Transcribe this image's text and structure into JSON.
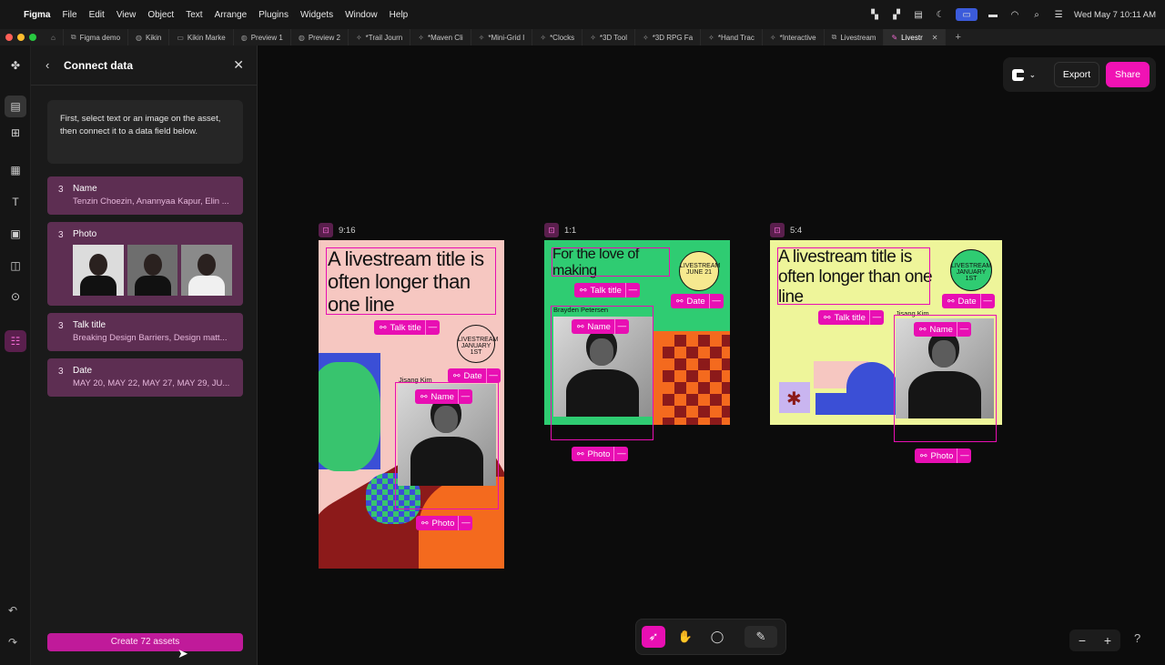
{
  "menubar": {
    "apple": "",
    "app": "Figma",
    "items": [
      "File",
      "Edit",
      "View",
      "Object",
      "Text",
      "Arrange",
      "Plugins",
      "Widgets",
      "Window",
      "Help"
    ],
    "datetime": "Wed May 7  10:11 AM"
  },
  "tabs": [
    {
      "label": "Figma demo"
    },
    {
      "label": "Kikin"
    },
    {
      "label": "Kikin Marke"
    },
    {
      "label": "Preview 1"
    },
    {
      "label": "Preview 2"
    },
    {
      "label": "*Trail Journ"
    },
    {
      "label": "*Maven Cli"
    },
    {
      "label": "*Mini-Grid I"
    },
    {
      "label": "*Clocks"
    },
    {
      "label": "*3D Tool"
    },
    {
      "label": "*3D RPG Fa"
    },
    {
      "label": "*Hand Trac"
    },
    {
      "label": "*Interactive"
    },
    {
      "label": "Livestream"
    },
    {
      "label": "Livestr"
    }
  ],
  "panel": {
    "title": "Connect data",
    "help": "First, select text or an image on the asset, then connect it to a data field below.",
    "fields": [
      {
        "count": "3",
        "label": "Name",
        "values": "Tenzin Choezin, Anannyaa Kapur, Elin ..."
      },
      {
        "count": "3",
        "label": "Photo",
        "values": ""
      },
      {
        "count": "3",
        "label": "Talk title",
        "values": "Breaking Design Barriers, Design matt..."
      },
      {
        "count": "3",
        "label": "Date",
        "values": "MAY 20, MAY 22, MAY 27, MAY 29, JU..."
      }
    ],
    "create_label": "Create 72 assets"
  },
  "header": {
    "export": "Export",
    "share": "Share"
  },
  "frames": [
    {
      "ratio": "9:16",
      "headline": "A livestream title is often longer than one line",
      "person": "Jisang Kim",
      "badge": "LIVESTREAM JANUARY 1ST"
    },
    {
      "ratio": "1:1",
      "headline": "For the love of making",
      "person": "Brayden Petersen",
      "badge": "LIVESTREAM JUNE 21"
    },
    {
      "ratio": "5:4",
      "headline": "A livestream title is often longer than one line",
      "person": "Jisang Kim",
      "badge": "LIVESTREAM JANUARY 1ST"
    }
  ],
  "chips": {
    "talk": "Talk title",
    "date": "Date",
    "name": "Name",
    "photo": "Photo",
    "minus": "—",
    "link": "⚯"
  },
  "colors": {
    "accent": "#e80fb3",
    "panel_field": "#5d2e52",
    "create": "#c01a9a"
  },
  "icons": {
    "back": "back-chevron-icon",
    "close": "close-icon",
    "lock": "lock-icon",
    "link": "link-icon"
  }
}
